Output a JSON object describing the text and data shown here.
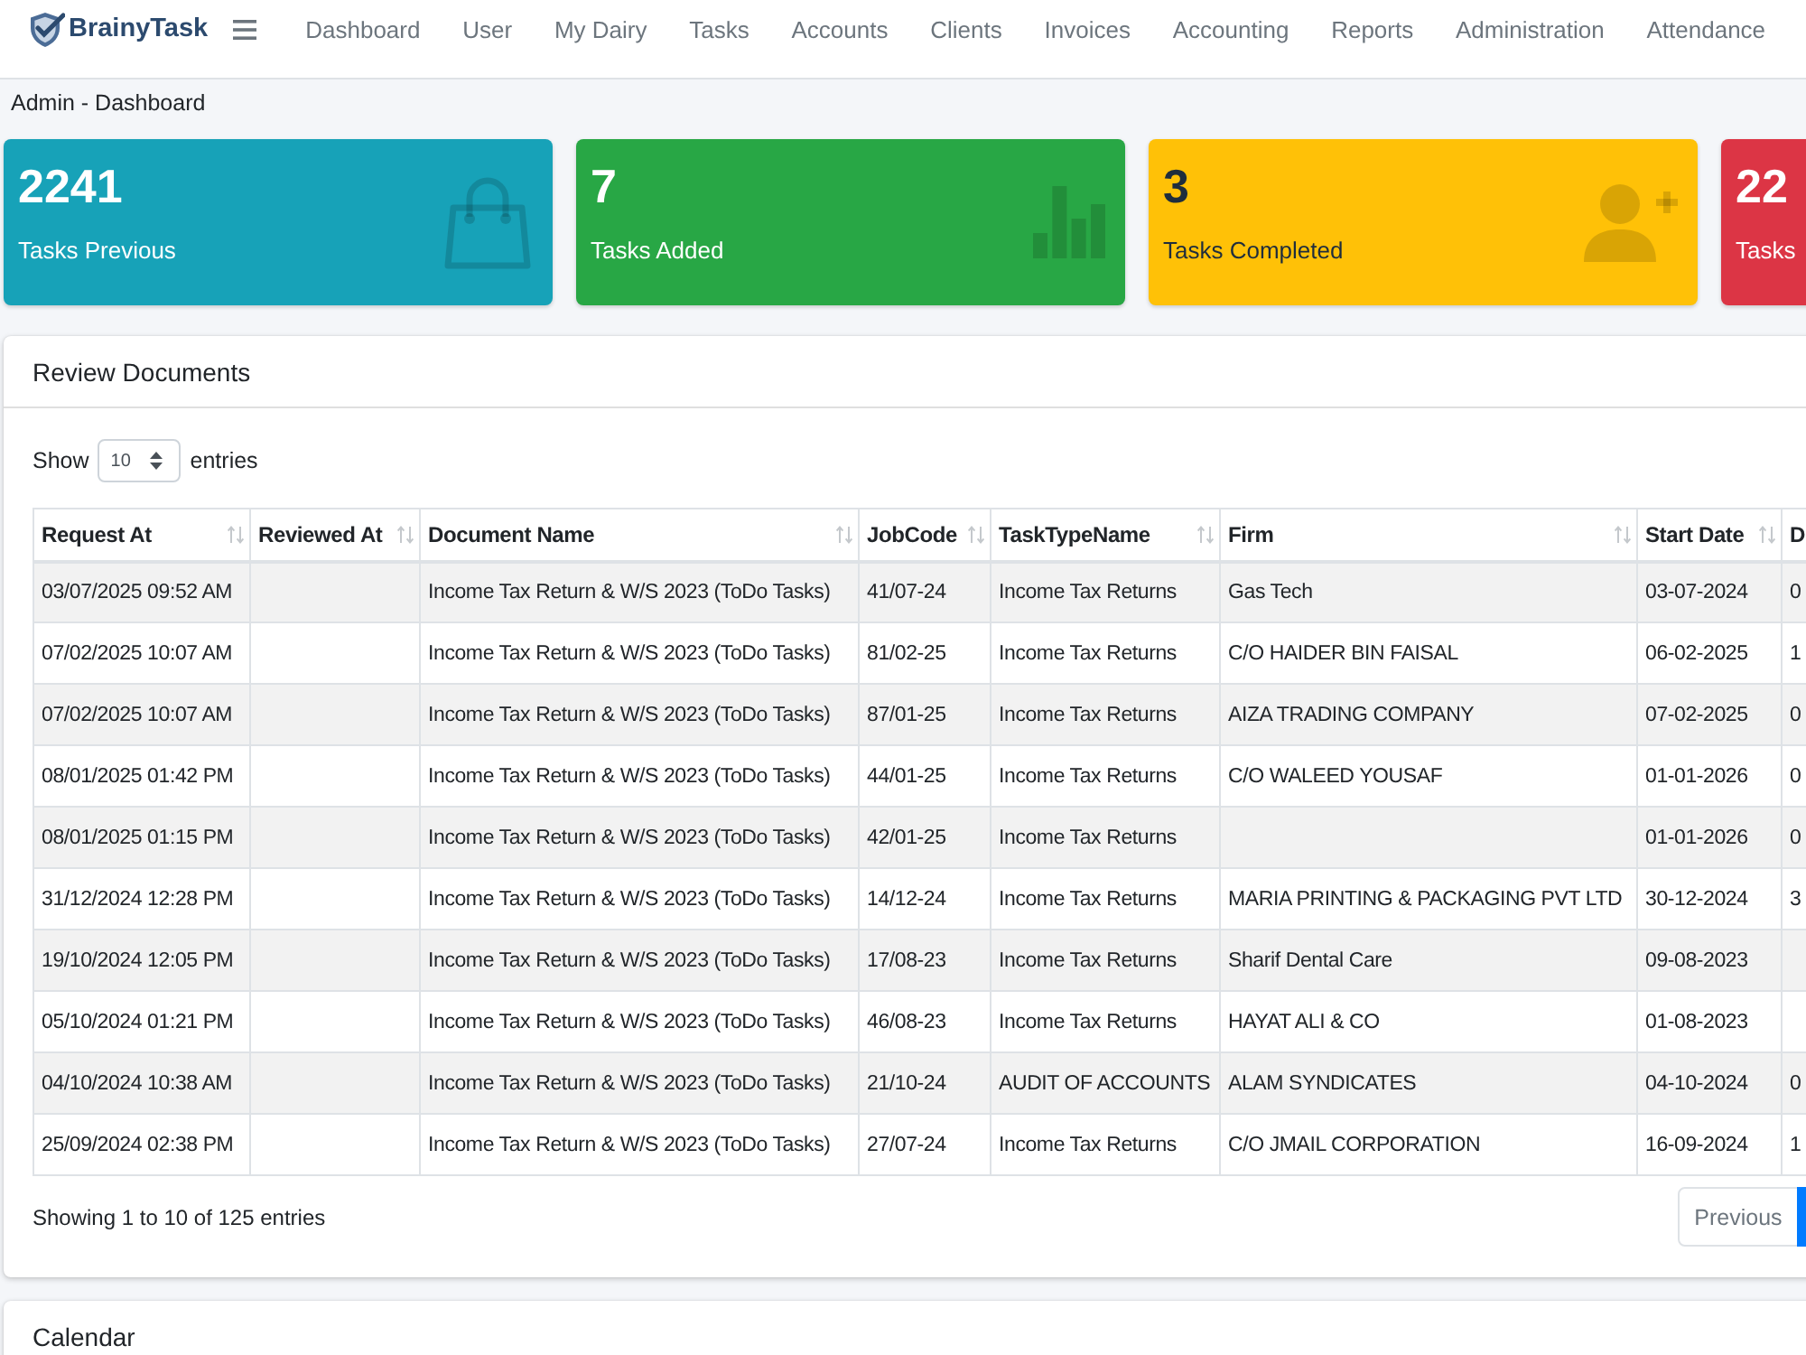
{
  "navbar": {
    "brand": "BrainyTask",
    "links": [
      "Dashboard",
      "User",
      "My Dairy",
      "Tasks",
      "Accounts",
      "Clients",
      "Invoices",
      "Accounting",
      "Reports",
      "Administration",
      "Attendance"
    ]
  },
  "breadcrumb": "Admin - Dashboard",
  "stat_cards": [
    {
      "value": "2241",
      "label": "Tasks Previous",
      "color": "#17a2b8"
    },
    {
      "value": "7",
      "label": "Tasks Added",
      "color": "#28a745"
    },
    {
      "value": "3",
      "label": "Tasks Completed",
      "color": "#ffc107"
    },
    {
      "value": "22",
      "label": "Tasks",
      "color": "#dc3545"
    }
  ],
  "review_documents": {
    "title": "Review Documents",
    "length_menu": {
      "prefix": "Show",
      "value": "10",
      "suffix": "entries"
    },
    "table": {
      "columns": [
        {
          "label": "Request At",
          "sortable": true
        },
        {
          "label": "Reviewed At",
          "sortable": true
        },
        {
          "label": "Document Name",
          "sortable": true
        },
        {
          "label": "JobCode",
          "sortable": true
        },
        {
          "label": "TaskTypeName",
          "sortable": true
        },
        {
          "label": "Firm",
          "sortable": true
        },
        {
          "label": "Start Date",
          "sortable": true
        },
        {
          "label": "D",
          "sortable": false
        }
      ],
      "rows": [
        {
          "cells": [
            "03/07/2025 09:52 AM",
            null,
            "Income Tax Return & W/S 2023 (ToDo Tasks)",
            "41/07-24",
            "Income Tax Returns",
            "Gas Tech",
            "03-07-2024",
            "0"
          ]
        },
        {
          "cells": [
            "07/02/2025 10:07 AM",
            null,
            "Income Tax Return & W/S 2023 (ToDo Tasks)",
            "81/02-25",
            "Income Tax Returns",
            "C/O HAIDER BIN FAISAL",
            "06-02-2025",
            "1"
          ]
        },
        {
          "cells": [
            "07/02/2025 10:07 AM",
            null,
            "Income Tax Return & W/S 2023 (ToDo Tasks)",
            "87/01-25",
            "Income Tax Returns",
            "AIZA TRADING COMPANY",
            "07-02-2025",
            "0"
          ]
        },
        {
          "cells": [
            "08/01/2025 01:42 PM",
            null,
            "Income Tax Return & W/S 2023 (ToDo Tasks)",
            "44/01-25",
            "Income Tax Returns",
            "C/O WALEED YOUSAF",
            "01-01-2026",
            "0"
          ]
        },
        {
          "cells": [
            "08/01/2025 01:15 PM",
            null,
            "Income Tax Return & W/S 2023 (ToDo Tasks)",
            "42/01-25",
            "Income Tax Returns",
            null,
            "01-01-2026",
            "0"
          ]
        },
        {
          "cells": [
            "31/12/2024 12:28 PM",
            null,
            "Income Tax Return & W/S 2023 (ToDo Tasks)",
            "14/12-24",
            "Income Tax Returns",
            "MARIA PRINTING & PACKAGING PVT LTD",
            "30-12-2024",
            "3"
          ]
        },
        {
          "cells": [
            "19/10/2024 12:05 PM",
            null,
            "Income Tax Return & W/S 2023 (ToDo Tasks)",
            "17/08-23",
            "Income Tax Returns",
            "Sharif Dental Care",
            "09-08-2023",
            null
          ]
        },
        {
          "cells": [
            "05/10/2024 01:21 PM",
            null,
            "Income Tax Return & W/S 2023 (ToDo Tasks)",
            "46/08-23",
            "Income Tax Returns",
            "HAYAT ALI & CO",
            "01-08-2023",
            null
          ]
        },
        {
          "cells": [
            "04/10/2024 10:38 AM",
            null,
            "Income Tax Return & W/S 2023 (ToDo Tasks)",
            "21/10-24",
            "AUDIT OF ACCOUNTS",
            "ALAM SYNDICATES",
            "04-10-2024",
            "0"
          ]
        },
        {
          "cells": [
            "25/09/2024 02:38 PM",
            null,
            "Income Tax Return & W/S 2023 (ToDo Tasks)",
            "27/07-24",
            "Income Tax Returns",
            "C/O JMAIL CORPORATION",
            "16-09-2024",
            "1"
          ]
        }
      ]
    },
    "info": "Showing 1 to 10 of 125 entries",
    "pagination": {
      "previous": "Previous",
      "pages": [
        {
          "selected": true
        }
      ]
    }
  },
  "calendar": {
    "title": "Calendar"
  }
}
